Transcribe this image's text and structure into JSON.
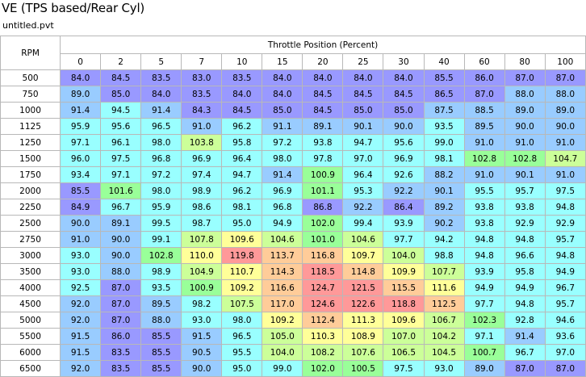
{
  "window": {
    "title": "VE (TPS based/Rear Cyl)",
    "filename": "untitled.pvt"
  },
  "table": {
    "corner_label": "RPM",
    "axis_label": "Throttle Position (Percent)",
    "columns": [
      "0",
      "2",
      "5",
      "7",
      "10",
      "15",
      "20",
      "25",
      "30",
      "40",
      "60",
      "80",
      "100"
    ],
    "rows": [
      {
        "rpm": "500",
        "values": [
          "84.0",
          "84.5",
          "83.5",
          "83.0",
          "83.5",
          "84.0",
          "84.0",
          "84.0",
          "84.0",
          "85.5",
          "86.0",
          "87.0",
          "87.0"
        ]
      },
      {
        "rpm": "750",
        "values": [
          "89.0",
          "85.0",
          "84.0",
          "83.5",
          "84.0",
          "84.0",
          "84.5",
          "84.5",
          "84.5",
          "86.5",
          "87.0",
          "88.0",
          "88.0"
        ]
      },
      {
        "rpm": "1000",
        "values": [
          "91.4",
          "94.5",
          "91.4",
          "84.3",
          "84.5",
          "85.0",
          "84.5",
          "85.0",
          "85.0",
          "87.5",
          "88.5",
          "89.0",
          "89.0"
        ]
      },
      {
        "rpm": "1125",
        "values": [
          "95.9",
          "95.6",
          "96.5",
          "91.0",
          "96.2",
          "91.1",
          "89.1",
          "90.1",
          "90.0",
          "93.5",
          "89.5",
          "90.0",
          "90.0"
        ]
      },
      {
        "rpm": "1250",
        "values": [
          "97.1",
          "96.1",
          "98.0",
          "103.8",
          "95.8",
          "97.2",
          "93.8",
          "94.7",
          "95.6",
          "99.0",
          "91.0",
          "91.0",
          "91.0"
        ]
      },
      {
        "rpm": "1500",
        "values": [
          "96.0",
          "97.5",
          "96.8",
          "96.9",
          "96.4",
          "98.0",
          "97.8",
          "97.0",
          "96.9",
          "98.1",
          "102.8",
          "102.8",
          "104.7"
        ]
      },
      {
        "rpm": "1750",
        "values": [
          "93.4",
          "97.1",
          "97.2",
          "97.4",
          "94.7",
          "91.4",
          "100.9",
          "96.4",
          "92.6",
          "88.2",
          "91.0",
          "90.1",
          "91.0"
        ]
      },
      {
        "rpm": "2000",
        "values": [
          "85.5",
          "101.6",
          "98.0",
          "98.9",
          "96.2",
          "96.9",
          "101.1",
          "95.3",
          "92.2",
          "90.1",
          "95.5",
          "95.7",
          "97.5"
        ]
      },
      {
        "rpm": "2250",
        "values": [
          "84.9",
          "96.7",
          "95.9",
          "98.6",
          "98.1",
          "96.8",
          "86.8",
          "92.2",
          "86.4",
          "89.2",
          "93.8",
          "93.8",
          "94.8"
        ]
      },
      {
        "rpm": "2500",
        "values": [
          "90.0",
          "89.1",
          "99.5",
          "98.7",
          "95.0",
          "94.9",
          "102.0",
          "99.4",
          "93.9",
          "90.2",
          "93.8",
          "92.9",
          "92.9"
        ]
      },
      {
        "rpm": "2750",
        "values": [
          "91.0",
          "90.0",
          "99.1",
          "107.8",
          "109.6",
          "104.6",
          "101.0",
          "104.6",
          "97.7",
          "94.2",
          "94.8",
          "94.8",
          "95.7"
        ]
      },
      {
        "rpm": "3000",
        "values": [
          "93.0",
          "90.0",
          "102.8",
          "110.0",
          "119.8",
          "113.7",
          "116.8",
          "109.7",
          "104.0",
          "98.8",
          "94.8",
          "96.6",
          "94.8"
        ]
      },
      {
        "rpm": "3500",
        "values": [
          "93.0",
          "88.0",
          "98.9",
          "104.9",
          "110.7",
          "114.3",
          "118.5",
          "114.8",
          "109.9",
          "107.7",
          "93.9",
          "95.8",
          "94.9"
        ]
      },
      {
        "rpm": "4000",
        "values": [
          "92.5",
          "87.0",
          "93.5",
          "100.9",
          "109.2",
          "116.6",
          "124.7",
          "121.5",
          "115.5",
          "111.6",
          "94.9",
          "94.9",
          "96.7"
        ]
      },
      {
        "rpm": "4500",
        "values": [
          "92.0",
          "87.0",
          "89.5",
          "98.2",
          "107.5",
          "117.0",
          "124.6",
          "122.6",
          "118.8",
          "112.5",
          "97.7",
          "94.8",
          "95.7"
        ]
      },
      {
        "rpm": "5000",
        "values": [
          "92.0",
          "87.0",
          "88.0",
          "93.0",
          "98.0",
          "109.2",
          "112.4",
          "111.3",
          "109.6",
          "106.7",
          "102.3",
          "92.8",
          "94.6"
        ]
      },
      {
        "rpm": "5500",
        "values": [
          "91.5",
          "86.0",
          "85.5",
          "91.5",
          "96.5",
          "105.0",
          "110.3",
          "108.9",
          "107.0",
          "104.2",
          "97.1",
          "91.4",
          "93.6"
        ]
      },
      {
        "rpm": "6000",
        "values": [
          "91.5",
          "83.5",
          "85.5",
          "90.5",
          "95.5",
          "104.0",
          "108.2",
          "107.6",
          "106.5",
          "104.5",
          "100.7",
          "96.7",
          "97.0"
        ]
      },
      {
        "rpm": "6500",
        "values": [
          "92.0",
          "83.5",
          "85.5",
          "90.0",
          "95.0",
          "99.0",
          "102.0",
          "100.5",
          "97.5",
          "93.0",
          "89.0",
          "87.0",
          "87.0"
        ]
      }
    ]
  },
  "colors": {
    "scale": [
      "#9999ff",
      "#99ccff",
      "#99ffff",
      "#99ff99",
      "#ccff99",
      "#ffff99",
      "#ffcc99",
      "#ff9999"
    ],
    "thresholds": [
      87.5,
      92.5,
      100,
      103.5,
      108.5,
      112.0,
      118.5
    ]
  }
}
